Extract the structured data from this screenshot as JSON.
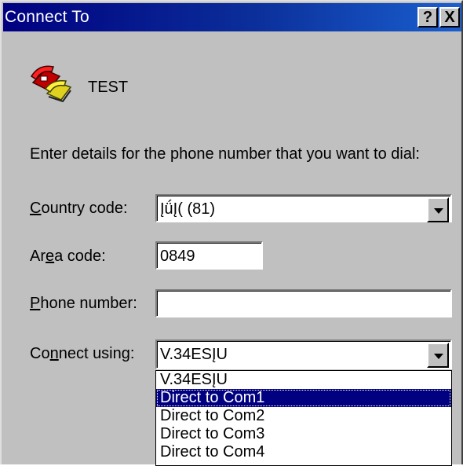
{
  "window": {
    "title": "Connect To",
    "help_button": "?",
    "close_button": "X"
  },
  "entry": {
    "name": "TEST",
    "icon": "phone-icon"
  },
  "instructions": "Enter details for the phone number that you want to dial:",
  "fields": {
    "country_code": {
      "label_pre": "",
      "label_key": "C",
      "label_post": "ountry code:",
      "value": "ĮǘĮ( (81)"
    },
    "area_code": {
      "label_pre": "Ar",
      "label_key": "e",
      "label_post": "a code:",
      "value": "0849"
    },
    "phone_number": {
      "label_pre": "",
      "label_key": "P",
      "label_post": "hone number:",
      "value": ""
    },
    "connect_using": {
      "label_pre": "Co",
      "label_key": "n",
      "label_post": "nect using:",
      "value": "V.34ESĮU"
    }
  },
  "dropdown_options": [
    "V.34ESĮU",
    "Direct to Com1",
    "Direct to Com2",
    "Direct to Com3",
    "Direct to Com4"
  ],
  "selected_option": "Direct to Com1",
  "colors": {
    "title_bar": "#000080",
    "selection": "#000080",
    "face": "#c0c0c0"
  }
}
